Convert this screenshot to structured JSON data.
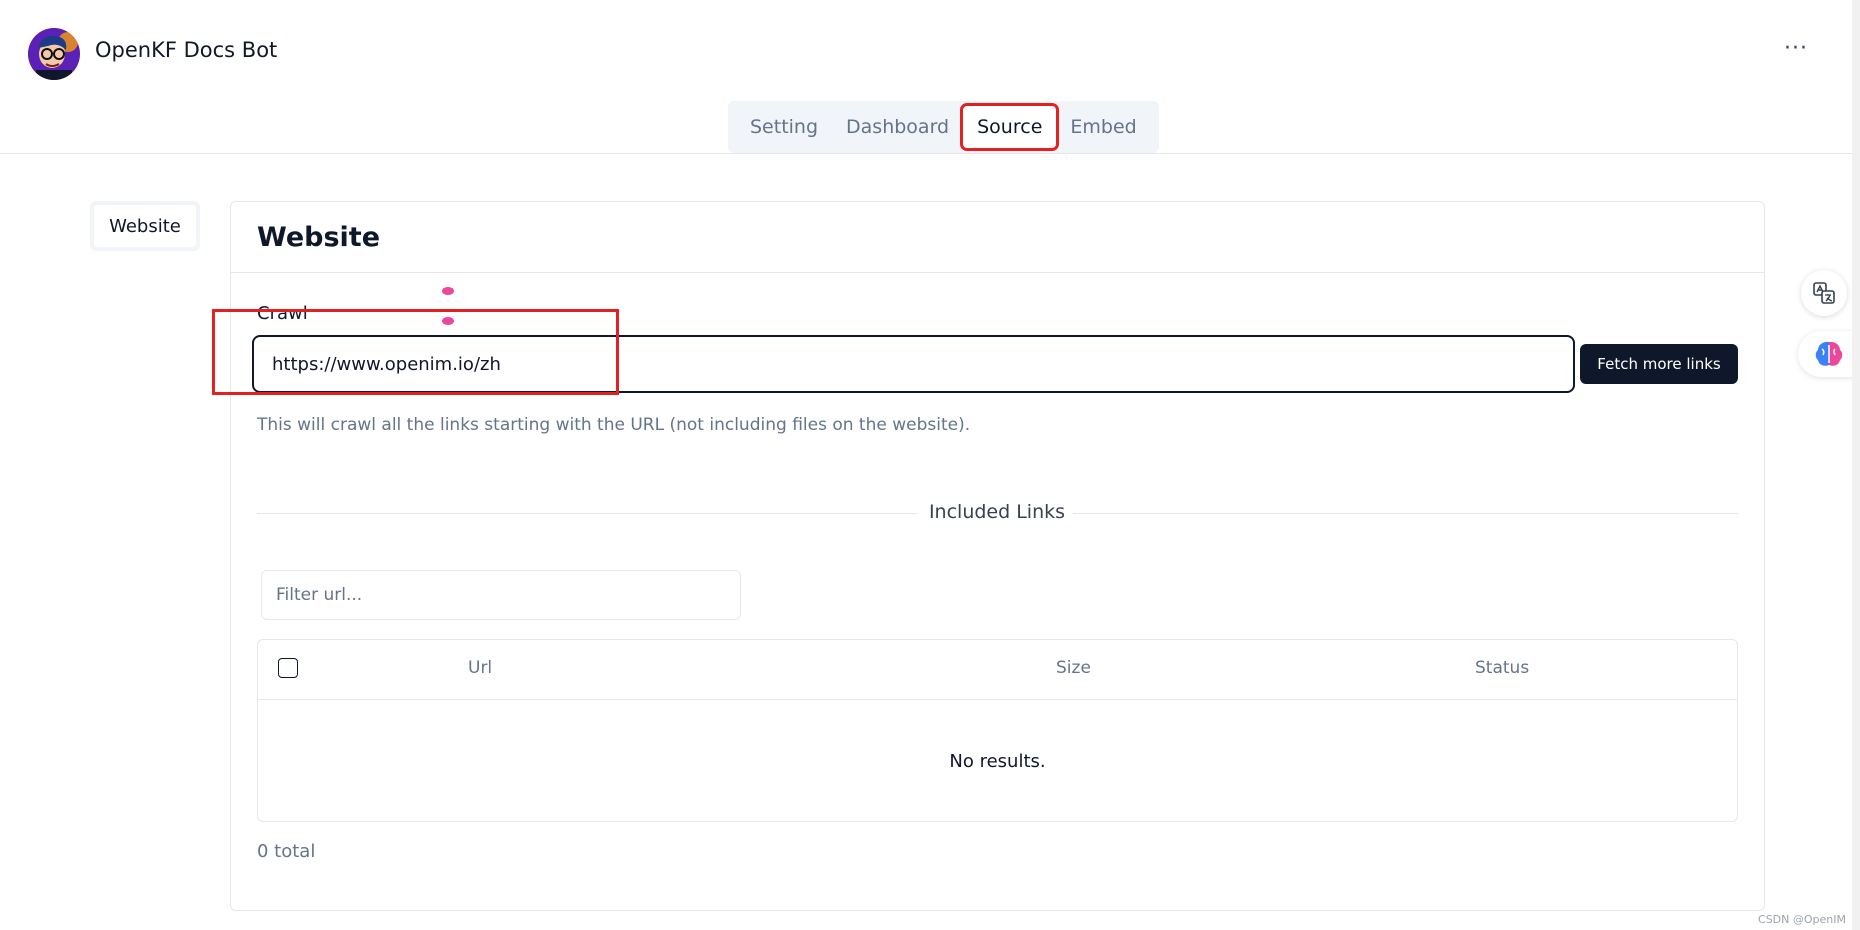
{
  "header": {
    "app_title": "OpenKF Docs Bot",
    "more_label": "···",
    "tabs": [
      {
        "label": "Setting"
      },
      {
        "label": "Dashboard"
      },
      {
        "label": "Source",
        "active": true
      },
      {
        "label": "Embed"
      }
    ]
  },
  "side_nav": {
    "items": [
      {
        "label": "Website",
        "active": true
      }
    ]
  },
  "main": {
    "title": "Website",
    "crawl_label": "Crawl",
    "crawl_value": "https://www.openim.io/zh",
    "fetch_button": "Fetch more links",
    "helper_text": "This will crawl all the links starting with the URL (not including files on the website).",
    "separator_label": "Included Links",
    "filter_placeholder": "Filter url...",
    "table": {
      "columns": [
        "Url",
        "Size",
        "Status"
      ],
      "empty_text": "No results."
    },
    "total_text": "0 total"
  },
  "watermark": "CSDN @OpenIM",
  "colors": {
    "accent": "#0f172a",
    "annotation": "#e52020",
    "muted": "#64748b"
  }
}
